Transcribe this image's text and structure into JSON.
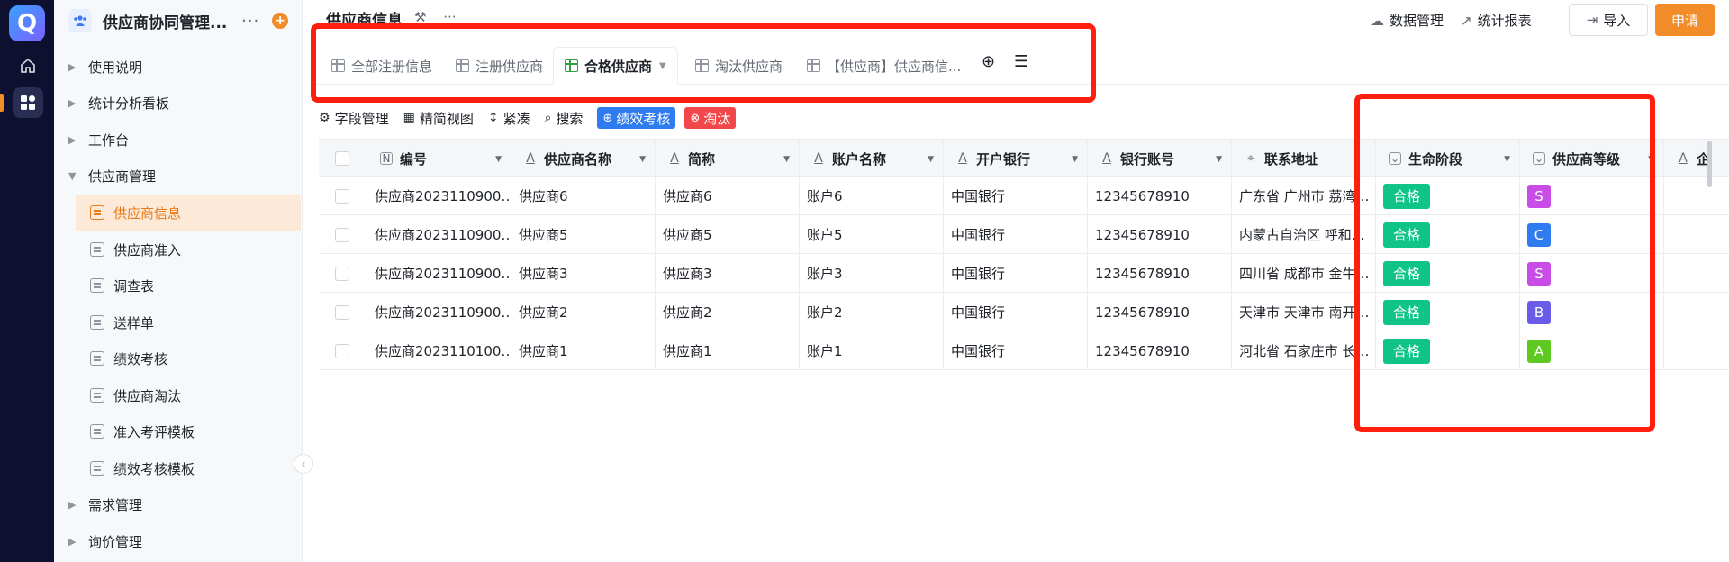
{
  "rail": {
    "logo": "Q"
  },
  "sidebar": {
    "app_title": "供应商协同管理...",
    "more": "···",
    "add": "+",
    "items": [
      {
        "label": "使用说明"
      },
      {
        "label": "统计分析看板"
      },
      {
        "label": "工作台"
      },
      {
        "label": "供应商管理"
      }
    ],
    "subitems": [
      {
        "label": "供应商信息"
      },
      {
        "label": "供应商准入"
      },
      {
        "label": "调查表"
      },
      {
        "label": "送样单"
      },
      {
        "label": "绩效考核"
      },
      {
        "label": "供应商淘汰"
      },
      {
        "label": "准入考评模板"
      },
      {
        "label": "绩效考核模板"
      }
    ],
    "items_after": [
      {
        "label": "需求管理"
      },
      {
        "label": "询价管理"
      }
    ]
  },
  "header": {
    "title": "供应商信息",
    "data_mgmt": "数据管理",
    "stats_report": "统计报表",
    "import": "导入",
    "apply": "申请"
  },
  "tabs": [
    {
      "label": "全部注册信息"
    },
    {
      "label": "注册供应商"
    },
    {
      "label": "合格供应商"
    },
    {
      "label": "淘汰供应商"
    },
    {
      "label": "【供应商】供应商信..."
    }
  ],
  "toolbar": {
    "field_mgmt": "字段管理",
    "simple_view": "精简视图",
    "compact": "紧凑",
    "search": "搜索",
    "perf_review": "绩效考核",
    "eliminate": "淘汰"
  },
  "table": {
    "columns": [
      {
        "label": "编号"
      },
      {
        "label": "供应商名称"
      },
      {
        "label": "简称"
      },
      {
        "label": "账户名称"
      },
      {
        "label": "开户银行"
      },
      {
        "label": "银行账号"
      },
      {
        "label": "联系地址"
      },
      {
        "label": "生命阶段"
      },
      {
        "label": "供应商等级"
      },
      {
        "label": "企"
      }
    ],
    "rows": [
      {
        "id": "供应商2023110900…",
        "name": "供应商6",
        "short": "供应商6",
        "account": "账户6",
        "bank": "中国银行",
        "acct_no": "12345678910",
        "addr": "广东省 广州市 荔湾…",
        "stage": "合格",
        "grade": "S"
      },
      {
        "id": "供应商2023110900…",
        "name": "供应商5",
        "short": "供应商5",
        "account": "账户5",
        "bank": "中国银行",
        "acct_no": "12345678910",
        "addr": "内蒙古自治区 呼和…",
        "stage": "合格",
        "grade": "C"
      },
      {
        "id": "供应商2023110900…",
        "name": "供应商3",
        "short": "供应商3",
        "account": "账户3",
        "bank": "中国银行",
        "acct_no": "12345678910",
        "addr": "四川省 成都市 金牛…",
        "stage": "合格",
        "grade": "S"
      },
      {
        "id": "供应商2023110900…",
        "name": "供应商2",
        "short": "供应商2",
        "account": "账户2",
        "bank": "中国银行",
        "acct_no": "12345678910",
        "addr": "天津市 天津市 南开…",
        "stage": "合格",
        "grade": "B"
      },
      {
        "id": "供应商2023110100…",
        "name": "供应商1",
        "short": "供应商1",
        "account": "账户1",
        "bank": "中国银行",
        "acct_no": "12345678910",
        "addr": "河北省 石家庄市 长…",
        "stage": "合格",
        "grade": "A"
      }
    ]
  },
  "colors": {
    "accent": "#f28c28",
    "stage_green": "#10c488",
    "grade_S": "#c94ce6",
    "grade_C": "#2f7bf0",
    "grade_B": "#6a5ce8",
    "grade_A": "#5ec921",
    "perf_chip": "#2f7bf0",
    "elim_chip": "#f2474a",
    "annotation": "#ff1f0f"
  }
}
